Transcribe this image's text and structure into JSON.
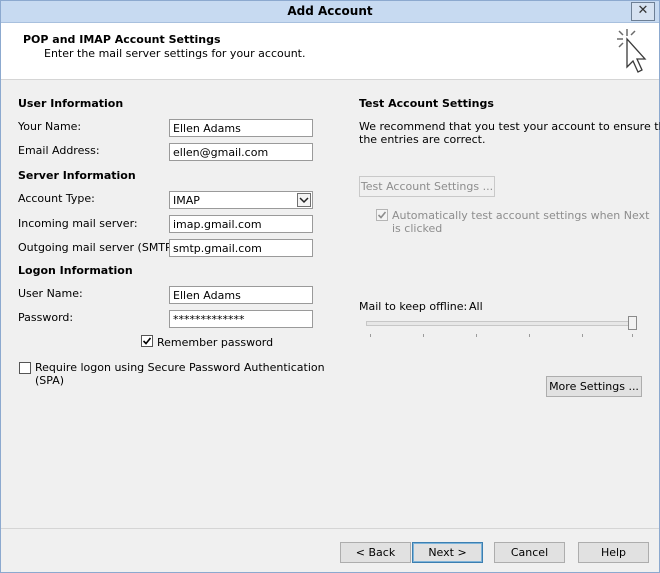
{
  "window": {
    "title": "Add Account",
    "close_glyph": "✕"
  },
  "header": {
    "title": "POP and IMAP Account Settings",
    "subtitle": "Enter the mail server settings for your account.",
    "icon": "cursor-click-icon"
  },
  "user_info": {
    "heading": "User Information",
    "name_label": "Your Name:",
    "name_value": "Ellen Adams",
    "email_label": "Email Address:",
    "email_value": "ellen@gmail.com"
  },
  "server_info": {
    "heading": "Server Information",
    "account_type_label": "Account Type:",
    "account_type_value": "IMAP",
    "incoming_label": "Incoming mail server:",
    "incoming_value": "imap.gmail.com",
    "outgoing_label": "Outgoing mail server (SMTP):",
    "outgoing_value": "smtp.gmail.com"
  },
  "logon_info": {
    "heading": "Logon Information",
    "username_label": "User Name:",
    "username_value": "Ellen Adams",
    "password_label": "Password:",
    "password_value": "*************",
    "remember_label": "Remember password",
    "remember_checked": true,
    "spa_label_line1": "Require logon using Secure Password Authentication",
    "spa_label_line2": "(SPA)",
    "spa_checked": false
  },
  "test_settings": {
    "heading": "Test Account Settings",
    "desc_line1": "We recommend that you test your account to ensure that",
    "desc_line2": "the entries are correct.",
    "test_button": "Test Account Settings ...",
    "auto_test_line1": "Automatically test account settings when Next",
    "auto_test_line2": "is clicked",
    "auto_test_checked": true,
    "offline_label": "Mail to keep offline:",
    "offline_value": "All",
    "offline_level_fraction": 1.0,
    "more_settings_button": "More Settings ..."
  },
  "footer": {
    "back": "< Back",
    "next": "Next >",
    "cancel": "Cancel",
    "help": "Help"
  },
  "colors": {
    "title_bar": "#c7daf1",
    "check": "#000000"
  }
}
